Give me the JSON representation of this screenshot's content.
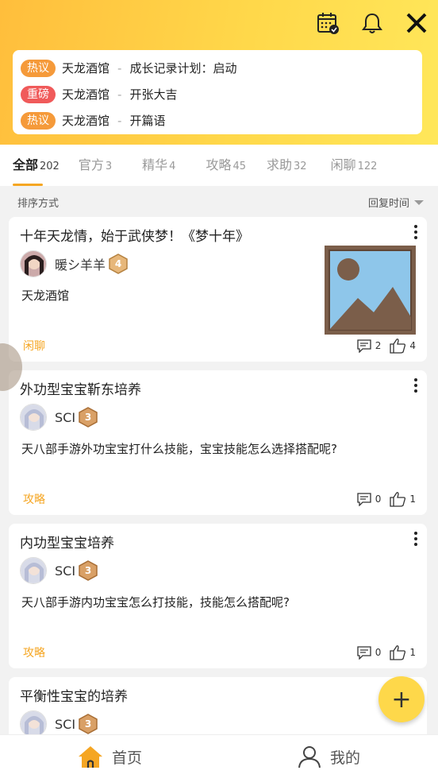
{
  "hot_topics": [
    {
      "badge": "热议",
      "badge_color": "#f59a3a",
      "forum": "天龙酒馆",
      "sep": "-",
      "title": "成长记录计划：启动"
    },
    {
      "badge": "重磅",
      "badge_color": "#f05a5a",
      "forum": "天龙酒馆",
      "sep": "-",
      "title": "开张大吉"
    },
    {
      "badge": "热议",
      "badge_color": "#f59a3a",
      "forum": "天龙酒馆",
      "sep": "-",
      "title": "开篇语"
    }
  ],
  "tabs": [
    {
      "label": "全部",
      "count": "202"
    },
    {
      "label": "官方",
      "count": "3"
    },
    {
      "label": "精华",
      "count": "4"
    },
    {
      "label": "攻略",
      "count": "45"
    },
    {
      "label": "求助",
      "count": "32"
    },
    {
      "label": "闲聊",
      "count": "122"
    }
  ],
  "sort": {
    "label": "排序方式",
    "value": "回复时间"
  },
  "posts": [
    {
      "title": "十年天龙情，始于武侠梦！《梦十年》",
      "author": "暖シ羊羊",
      "level": "4",
      "body": "天龙酒馆",
      "tag": "闲聊",
      "comments": "2",
      "likes": "4"
    },
    {
      "title": "外功型宝宝靳东培养",
      "author": "SCI",
      "level": "3",
      "body": "天八部手游外功宝宝打什么技能，宝宝技能怎么选择搭配呢?",
      "tag": "攻略",
      "comments": "0",
      "likes": "1"
    },
    {
      "title": "内功型宝宝培养",
      "author": "SCI",
      "level": "3",
      "body": "天八部手游内功宝宝怎么打技能，技能怎么搭配呢?",
      "tag": "攻略",
      "comments": "0",
      "likes": "1"
    },
    {
      "title": "平衡性宝宝的培养",
      "author": "SCI",
      "level": "3"
    }
  ],
  "fab": {
    "label": "+"
  },
  "bottom_nav": {
    "home": "首页",
    "mine": "我的"
  },
  "colors": {
    "accent": "#f5a623",
    "header": "#ffd84a"
  }
}
